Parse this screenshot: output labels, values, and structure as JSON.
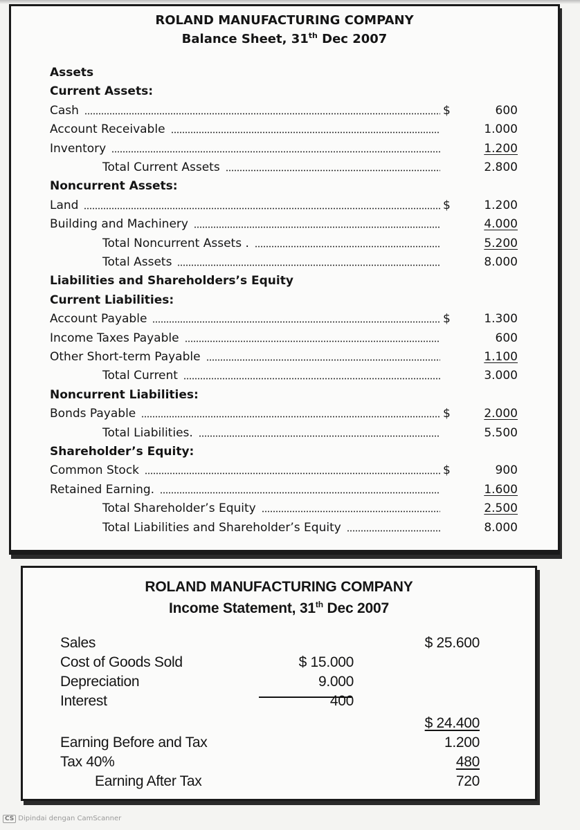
{
  "balance_sheet": {
    "company": "ROLAND MANUFACTURING COMPANY",
    "title_pre": "Balance Sheet, 31",
    "title_sup": "th",
    "title_post": " Dec 2007",
    "rows": [
      {
        "label": "Assets",
        "type": "head"
      },
      {
        "label": "Current Assets:",
        "type": "head"
      },
      {
        "label": "Cash",
        "currency": "$",
        "amount": "600"
      },
      {
        "label": "Account Receivable",
        "amount": "1.000"
      },
      {
        "label": "Inventory",
        "amount": "1.200",
        "underline": true
      },
      {
        "label": "Total Current Assets",
        "type": "indent",
        "amount": "2.800"
      },
      {
        "label": "Noncurrent Assets:",
        "type": "head"
      },
      {
        "label": "Land",
        "currency": "$",
        "amount": "1.200"
      },
      {
        "label": "Building and Machinery",
        "amount": "4.000",
        "underline": true
      },
      {
        "label": "Total Noncurrent Assets .",
        "type": "indent",
        "amount": "5.200",
        "underline": true
      },
      {
        "label": "Total Assets",
        "type": "indent",
        "amount": "8.000"
      },
      {
        "label": "Liabilities and Shareholders’s Equity",
        "type": "head"
      },
      {
        "label": "Current Liabilities:",
        "type": "head"
      },
      {
        "label": "Account Payable",
        "currency": "$",
        "amount": "1.300"
      },
      {
        "label": "Income Taxes Payable",
        "amount": "600"
      },
      {
        "label": "Other Short-term Payable",
        "amount": "1.100",
        "underline": true
      },
      {
        "label": "Total Current",
        "type": "indent",
        "amount": "3.000"
      },
      {
        "label": "Noncurrent Liabilities:",
        "type": "head"
      },
      {
        "label": "Bonds Payable",
        "currency": "$",
        "amount": "2.000",
        "underline": true
      },
      {
        "label": "Total Liabilities.",
        "type": "indent",
        "amount": "5.500"
      },
      {
        "label": "Shareholder’s Equity:",
        "type": "head"
      },
      {
        "label": "Common Stock",
        "currency": "$",
        "amount": "900"
      },
      {
        "label": "Retained Earning.",
        "amount": "1.600",
        "underline": true
      },
      {
        "label": "Total Shareholder’s Equity",
        "type": "indent",
        "amount": "2.500",
        "underline": true
      },
      {
        "label": "Total Liabilities and Shareholder’s Equity",
        "type": "indent",
        "amount": "8.000"
      }
    ]
  },
  "income_statement": {
    "company": "ROLAND MANUFACTURING COMPANY",
    "title_pre": "Income Statement, 31",
    "title_sup": "th",
    "title_post": " Dec 2007",
    "rows": [
      {
        "label": "Sales",
        "right": "$ 25.600"
      },
      {
        "label": "Cost of Goods Sold",
        "mid": "$ 15.000"
      },
      {
        "label": "Depreciation",
        "mid": "9.000"
      },
      {
        "label": "Interest",
        "mid": "400"
      },
      {
        "right": "$ 24.400",
        "right_underline": true
      },
      {
        "label": "Earning Before and Tax",
        "right": "1.200"
      },
      {
        "label": "Tax 40%",
        "right": "480",
        "right_underline": true
      },
      {
        "label": "Earning After Tax",
        "type": "indent",
        "right": "720"
      }
    ]
  },
  "footer": {
    "logo": "CS",
    "text": "Dipindai dengan CamScanner"
  }
}
